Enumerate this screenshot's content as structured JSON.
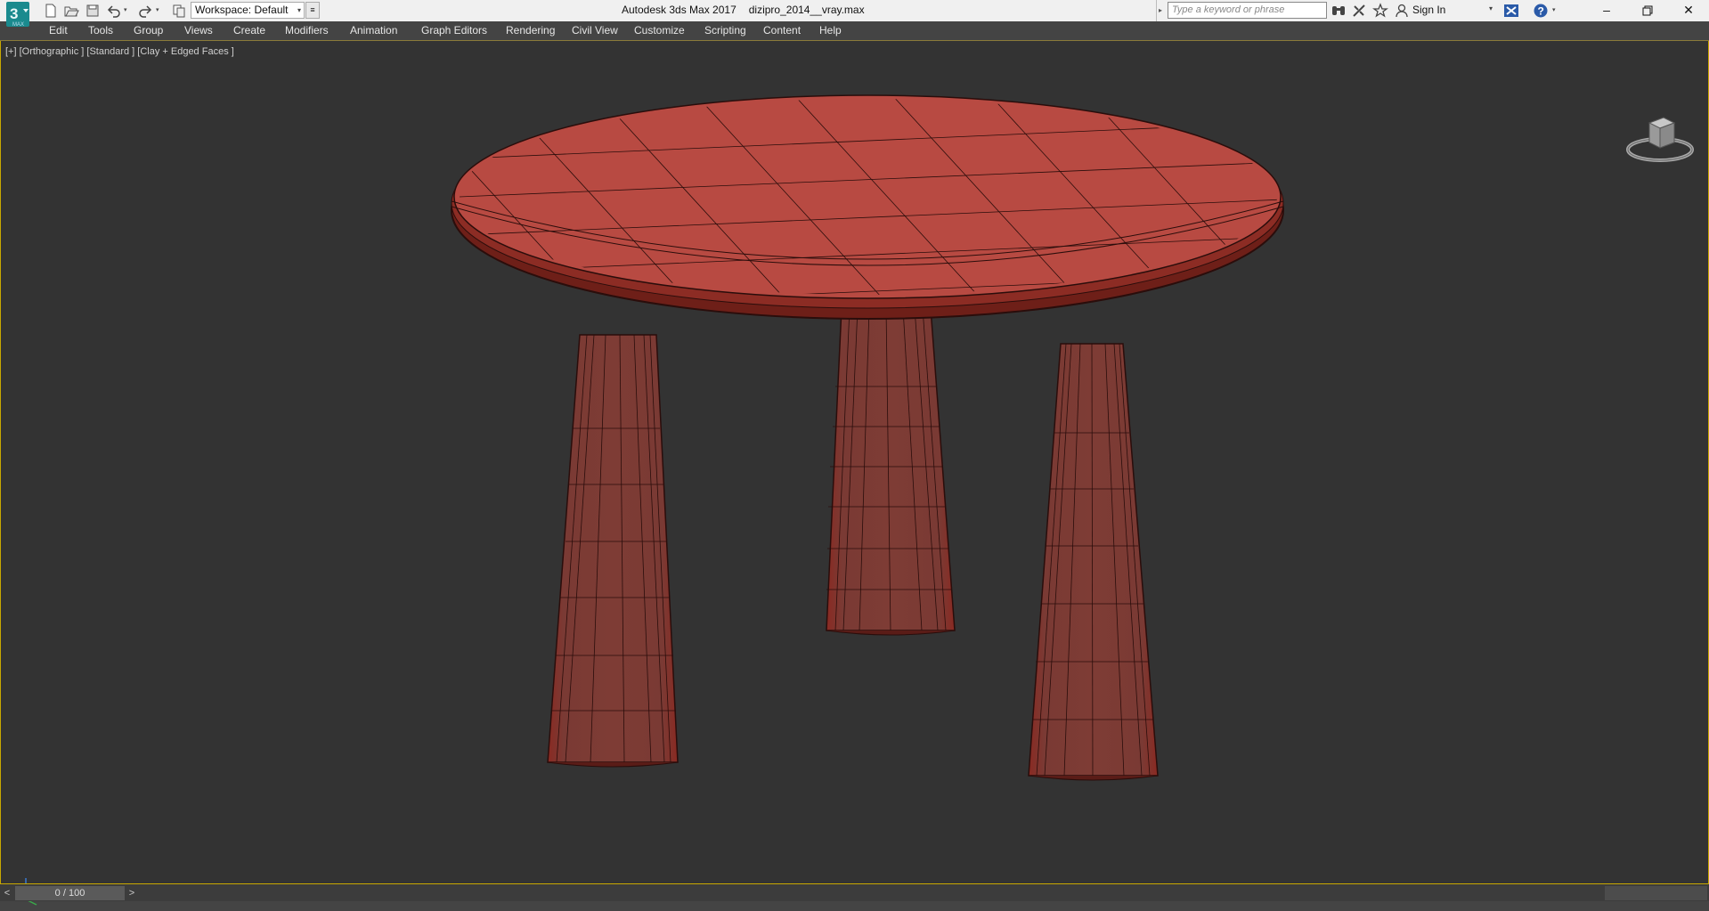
{
  "titlebar": {
    "app_name": "Autodesk 3ds Max 2017",
    "file_name": "dizipro_2014__vray.max",
    "workspace_label": "Workspace: Default",
    "search_placeholder": "Type a keyword or phrase",
    "sign_in_label": "Sign In",
    "logo_icon": "3ds-max-logo-icon",
    "quick_access_icons": [
      "new-file-icon",
      "open-file-icon",
      "save-icon",
      "undo-icon",
      "redo-icon",
      "project-folder-icon"
    ],
    "right_icons": [
      "binoculars-icon",
      "satellite-icon",
      "star-icon",
      "user-icon",
      "exchange-icon",
      "help-icon"
    ],
    "window_controls": [
      "minimize",
      "restore",
      "close"
    ]
  },
  "menu": {
    "items": [
      "Edit",
      "Tools",
      "Group",
      "Views",
      "Create",
      "Modifiers",
      "Animation",
      "Graph Editors",
      "Rendering",
      "Civil View",
      "Customize",
      "Scripting",
      "Content",
      "Help"
    ]
  },
  "viewport": {
    "label": "[+] [Orthographic ] [Standard ] [Clay + Edged Faces ]",
    "model_color": "#b84a42",
    "model_edge_color": "#2a0d0b",
    "background_color": "#333333",
    "viewcube_icon": "viewcube-icon",
    "axis_icon": "axis-tripod-icon"
  },
  "timeslider": {
    "prev_label": "<",
    "frame_label": "0 / 100",
    "next_label": ">"
  },
  "colors": {
    "accent": "#c8a800",
    "menubar_bg": "#444444",
    "titlebar_bg": "#f0f0f0"
  }
}
